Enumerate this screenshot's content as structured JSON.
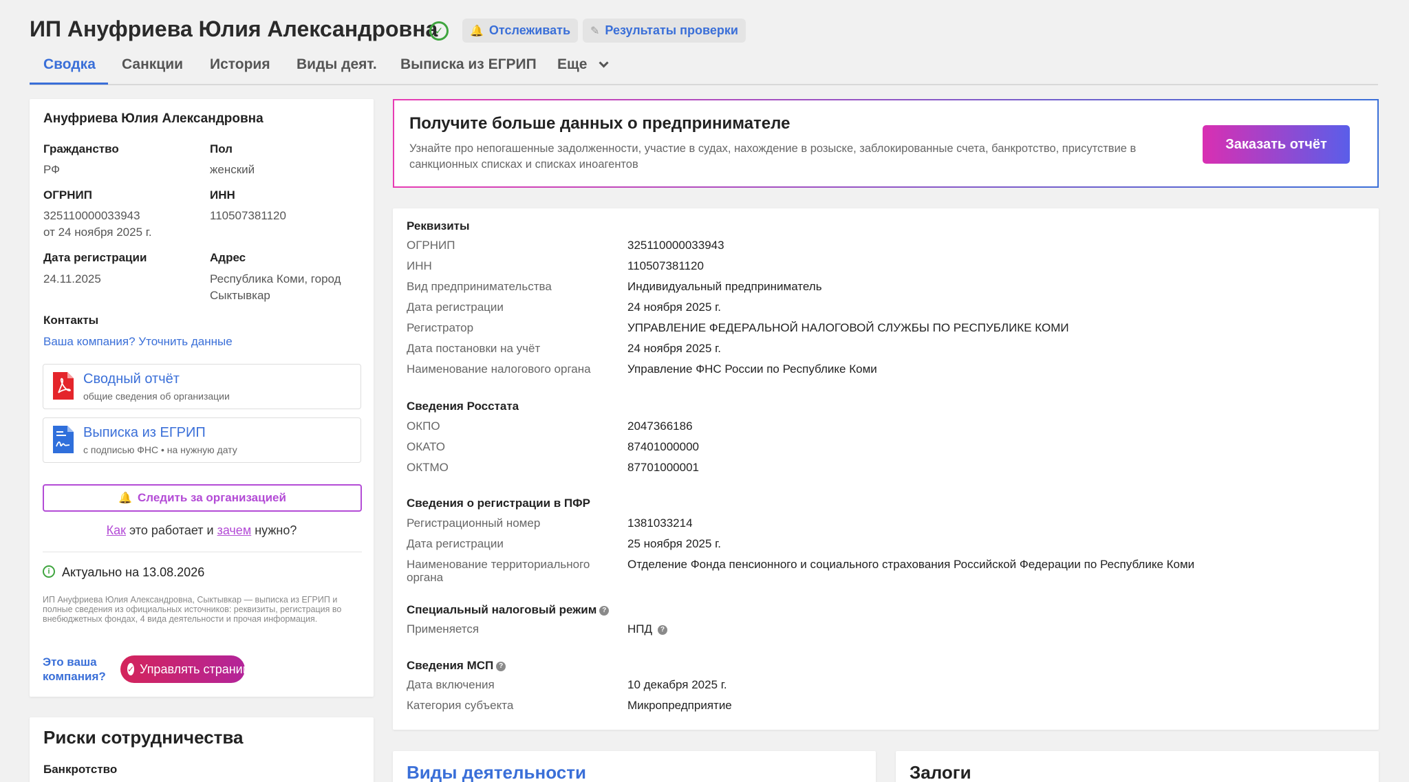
{
  "header": {
    "title": "ИП Ануфриева Юлия Александровна",
    "track_label": "Отслеживать",
    "check_results_label": "Результаты проверки"
  },
  "tabs": [
    {
      "label": "Сводка"
    },
    {
      "label": "Санкции"
    },
    {
      "label": "История"
    },
    {
      "label": "Виды деят."
    },
    {
      "label": "Выписка из ЕГРИП"
    },
    {
      "label": "Еще"
    }
  ],
  "person": {
    "name": "Ануфриева Юлия Александровна",
    "citizenship_label": "Гражданство",
    "citizenship_value": "РФ",
    "sex_label": "Пол",
    "sex_value": "женский",
    "ogrnip_label": "ОГРНИП",
    "ogrnip_value": "325110000033943",
    "ogrnip_date": "от 24 ноября 2025 г.",
    "inn_label": "ИНН",
    "inn_value": "110507381120",
    "regdate_label": "Дата регистрации",
    "regdate_value": "24.11.2025",
    "address_label": "Адрес",
    "address_value": "Республика Коми, город Сыктывкар",
    "contacts_label": "Контакты",
    "contacts_link": "Ваша компания? Уточнить данные"
  },
  "files": {
    "summary_title": "Сводный отчёт",
    "summary_sub": "общие сведения об организации",
    "extract_title": "Выписка из ЕГРИП",
    "extract_sub": "с подписью ФНС • на нужную дату"
  },
  "follow": {
    "button_label": "Следить за организацией",
    "how": "Как",
    "mid": " это работает и ",
    "why": "зачем",
    "end": " нужно?"
  },
  "actual": {
    "text": "Актуально на 13.08.2026",
    "description": "ИП Ануфриева Юлия Александровна, Сыктывкар — выписка из ЕГРИП и полные сведения из официальных источников: реквизиты, регистрация во внебюджетных фондах, 4 вида деятельности и прочая информация.",
    "your_company": "Это ваша компания?",
    "manage_label": "Управлять страницей"
  },
  "risks": {
    "title": "Риски сотрудничества",
    "bankruptcy": "Банкротство"
  },
  "promo": {
    "title": "Получите больше данных о предпринимателе",
    "text": "Узнайте про непогашенные задолженности, участие в судах, нахождение в розыске, заблокированные счета, банкротство, присутствие в санкционных списках и списках иноагентов",
    "button": "Заказать отчёт"
  },
  "requisites": {
    "title": "Реквизиты",
    "rows": [
      {
        "k": "ОГРНИП",
        "v": "325110000033943"
      },
      {
        "k": "ИНН",
        "v": "110507381120"
      },
      {
        "k": "Вид предпринимательства",
        "v": "Индивидуальный предприниматель"
      },
      {
        "k": "Дата регистрации",
        "v": "24 ноября 2025 г."
      },
      {
        "k": "Регистратор",
        "v": "УПРАВЛЕНИЕ ФЕДЕРАЛЬНОЙ НАЛОГОВОЙ СЛУЖБЫ ПО РЕСПУБЛИКЕ КОМИ"
      },
      {
        "k": "Дата постановки на учёт",
        "v": "24 ноября 2025 г."
      },
      {
        "k": "Наименование налогового органа",
        "v": "Управление ФНС России по Республике Коми"
      }
    ],
    "rosstat_title": "Сведения Росстата",
    "rosstat": [
      {
        "k": "ОКПО",
        "v": "2047366186"
      },
      {
        "k": "ОКАТО",
        "v": "87401000000"
      },
      {
        "k": "ОКТМО",
        "v": "87701000001"
      }
    ],
    "pfr_title": "Сведения о регистрации в ПФР",
    "pfr": [
      {
        "k": "Регистрационный номер",
        "v": "1381033214"
      },
      {
        "k": "Дата регистрации",
        "v": "25 ноября 2025 г."
      },
      {
        "k": "Наименование территориального органа",
        "v": "Отделение Фонда пенсионного и социального страхования Российской Федерации по Республике Коми"
      }
    ],
    "tax_title": "Специальный налоговый режим",
    "tax": [
      {
        "k": "Применяется",
        "v": "НПД"
      }
    ],
    "msp_title": "Сведения МСП",
    "msp": [
      {
        "k": "Дата включения",
        "v": "10 декабря 2025 г."
      },
      {
        "k": "Категория субъекта",
        "v": "Микропредприятие"
      }
    ]
  },
  "activities": {
    "title": "Виды деятельности"
  },
  "pledges": {
    "title": "Залоги"
  }
}
